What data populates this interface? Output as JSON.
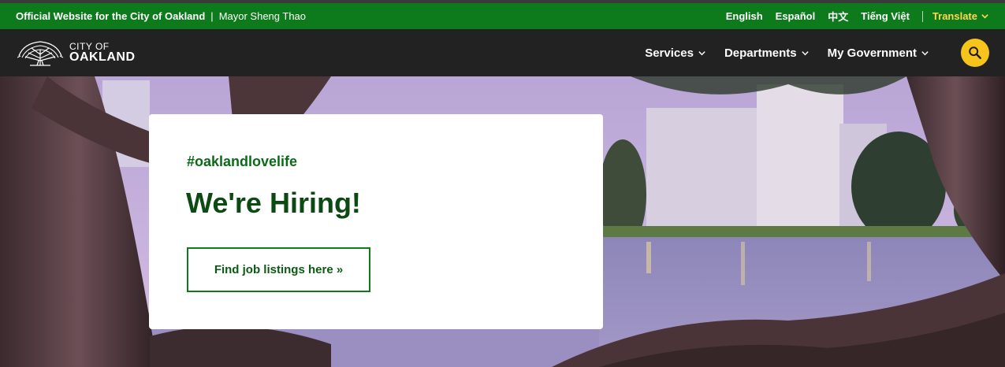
{
  "gov_bar": {
    "official": "Official Website for the City of Oakland",
    "separator": "|",
    "mayor": "Mayor Sheng Thao",
    "languages": [
      "English",
      "Español",
      "中文",
      "Tiếng Việt"
    ],
    "translate_label": "Translate"
  },
  "nav": {
    "logo_line1": "CITY OF",
    "logo_line2": "OAKLAND",
    "items": [
      {
        "label": "Services"
      },
      {
        "label": "Departments"
      },
      {
        "label": "My Government"
      }
    ]
  },
  "hero": {
    "hashtag": "#oaklandlovelife",
    "headline": "We're Hiring!",
    "cta_label": "Find job listings here »"
  },
  "colors": {
    "gov_bar_bg": "#0d7a1c",
    "nav_bg": "#222222",
    "accent_yellow": "#f6c41b",
    "heading_green": "#0b4a12"
  }
}
